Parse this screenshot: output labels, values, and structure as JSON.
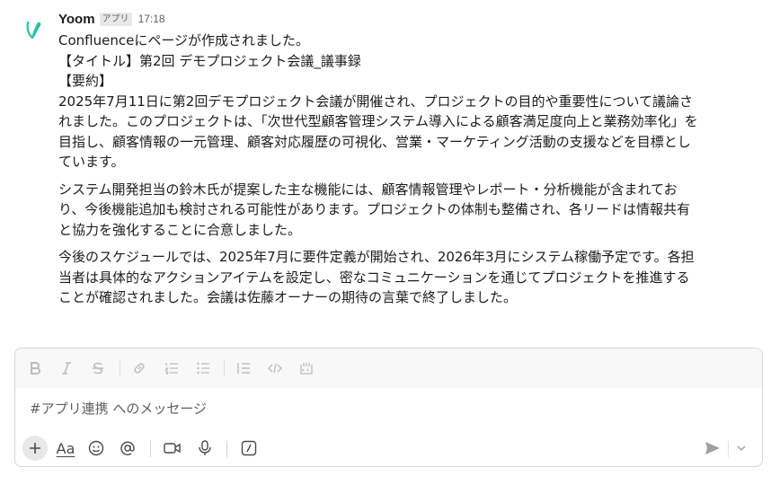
{
  "message": {
    "sender": "Yoom",
    "badge": "アプリ",
    "time": "17:18",
    "lines": [
      "Confluenceにページが作成されました。",
      "【タイトル】第2回 デモプロジェクト会議_議事録",
      "【要約】"
    ],
    "paragraphs": [
      [
        "2025年7月11日に第2回デモプロジェクト会議が開催され、プロジェクトの目的や重要性について議論さ",
        "れました。このプロジェクトは、「次世代型顧客管理システム導入による顧客満足度向上と業務効率化」を",
        "目指し、顧客情報の一元管理、顧客対応履歴の可視化、営業・マーケティング活動の支援などを目標とし",
        "ています。"
      ],
      [
        "システム開発担当の鈴木氏が提案した主な機能には、顧客情報管理やレポート・分析機能が含まれてお",
        "り、今後機能追加も検討される可能性があります。プロジェクトの体制も整備され、各リードは情報共有",
        "と協力を強化することに合意しました。"
      ],
      [
        "今後のスケジュールでは、2025年7月に要件定義が開始され、2026年3月にシステム稼働予定です。各担",
        "当者は具体的なアクションアイテムを設定し、密なコミュニケーションを通じてプロジェクトを推進する",
        "ことが確認されました。会議は佐藤オーナーの期待の言葉で終了しました。"
      ]
    ]
  },
  "composer": {
    "placeholder": "#アプリ連携 へのメッセージ",
    "format_tools": [
      "bold-icon",
      "italic-icon",
      "strikethrough-icon",
      "link-icon",
      "ordered-list-icon",
      "bullet-list-icon",
      "blockquote-icon",
      "code-icon",
      "code-block-icon"
    ],
    "bottom_tools": [
      "plus-icon",
      "text-format-icon",
      "emoji-icon",
      "mention-icon",
      "video-icon",
      "microphone-icon",
      "slash-command-icon",
      "send-icon",
      "chevron-down-icon"
    ],
    "format_label": "Aa"
  },
  "colors": {
    "avatar_accent": "#29c1a6",
    "text": "#1d1c1d",
    "muted": "#616061"
  }
}
